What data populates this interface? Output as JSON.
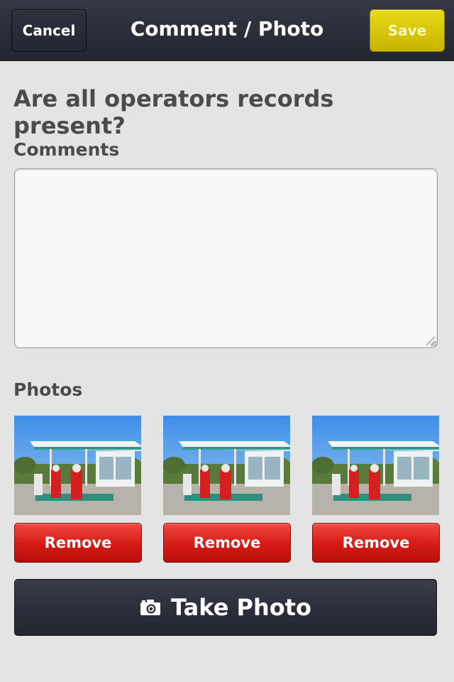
{
  "navbar": {
    "cancel_label": "Cancel",
    "title": "Comment / Photo",
    "save_label": "Save"
  },
  "question": "Are all operators records present?",
  "comments": {
    "label": "Comments",
    "value": ""
  },
  "photos": {
    "label": "Photos",
    "items": [
      {
        "remove_label": "Remove"
      },
      {
        "remove_label": "Remove"
      },
      {
        "remove_label": "Remove"
      }
    ]
  },
  "take_photo": {
    "label": "Take Photo",
    "icon": "camera-icon"
  },
  "colors": {
    "navbar": "#2a2c37",
    "save": "#d8c70a",
    "remove": "#d41a14",
    "background": "#e4e4e4"
  }
}
